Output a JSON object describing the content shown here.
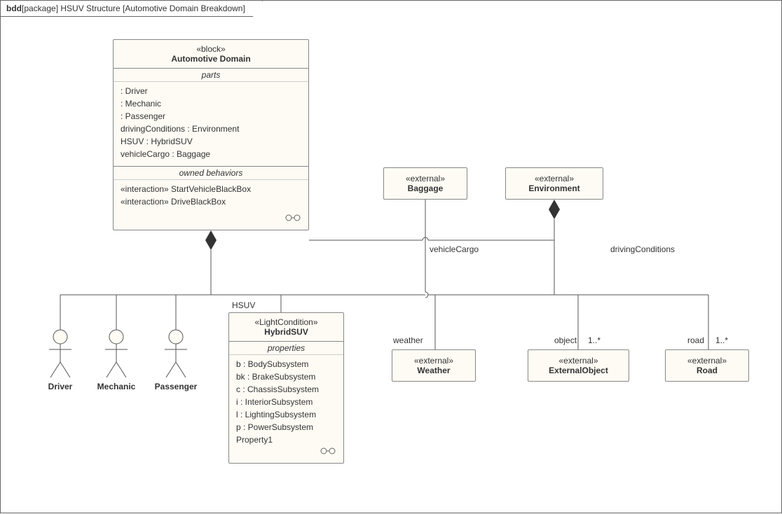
{
  "frame": {
    "kindStrong": "bdd",
    "rest": "[package] HSUV Structure [Automotive Domain Breakdown]"
  },
  "automotiveDomain": {
    "stereotype": "«block»",
    "name": "Automotive Domain",
    "partsTitle": "parts",
    "parts": [
      ": Driver",
      ": Mechanic",
      ": Passenger",
      "drivingConditions : Environment",
      "HSUV : HybridSUV",
      "vehicleCargo : Baggage"
    ],
    "behaviorsTitle": "owned behaviors",
    "behaviors": [
      "«interaction» StartVehicleBlackBox",
      "«interaction» DriveBlackBox"
    ]
  },
  "baggage": {
    "stereotype": "«external»",
    "name": "Baggage"
  },
  "environment": {
    "stereotype": "«external»",
    "name": "Environment"
  },
  "hybridSUV": {
    "stereotype": "«LightCondition»",
    "name": "HybridSUV",
    "propertiesTitle": "properties",
    "properties": [
      "b : BodySubsystem",
      "bk : BrakeSubsystem",
      "c : ChassisSubsystem",
      "i : InteriorSubsystem",
      "l : LightingSubsystem",
      "p : PowerSubsystem",
      "Property1"
    ]
  },
  "weather": {
    "stereotype": "«external»",
    "name": "Weather"
  },
  "externalObject": {
    "stereotype": "«external»",
    "name": "ExternalObject"
  },
  "road": {
    "stereotype": "«external»",
    "name": "Road"
  },
  "actors": {
    "driver": "Driver",
    "mechanic": "Mechanic",
    "passenger": "Passenger"
  },
  "labels": {
    "hsuv": "HSUV",
    "vehicleCargo": "vehicleCargo",
    "drivingConditions": "drivingConditions",
    "weather": "weather",
    "object": "object",
    "objectMult": "1..*",
    "road": "road",
    "roadMult": "1..*"
  }
}
